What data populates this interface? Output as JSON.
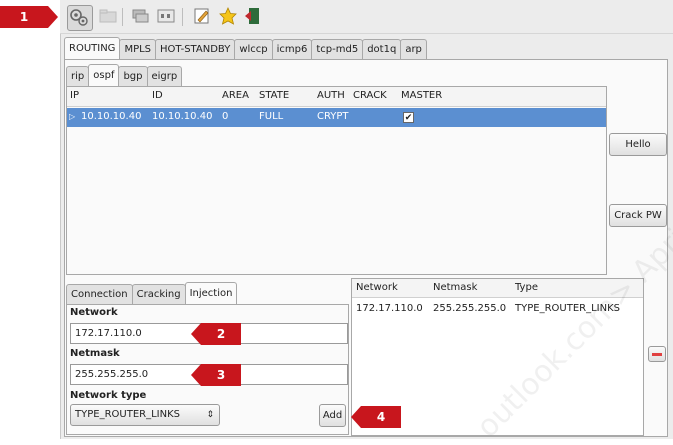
{
  "toolbar": {
    "icons": [
      "plugins-icon",
      "folder-icon",
      "network-icon",
      "interfaces-icon",
      "edit-icon",
      "star-icon",
      "exit-icon"
    ]
  },
  "protocol_tabs": [
    "ROUTING",
    "MPLS",
    "HOT-STANDBY",
    "wlccp",
    "icmp6",
    "tcp-md5",
    "dot1q",
    "arp"
  ],
  "routing_tabs": [
    "rip",
    "ospf",
    "bgp",
    "eigrp"
  ],
  "neighbors": {
    "columns": [
      "IP",
      "ID",
      "AREA",
      "STATE",
      "AUTH",
      "CRACK",
      "MASTER"
    ],
    "rows": [
      {
        "ip": "10.10.10.40",
        "id": "10.10.10.40",
        "area": "0",
        "state": "FULL",
        "auth": "CRYPT",
        "crack": "",
        "master": "✔"
      }
    ]
  },
  "buttons": {
    "hello": "Hello",
    "crack_pw": "Crack PW",
    "add": "Add"
  },
  "bottom_tabs": [
    "Connection",
    "Cracking",
    "Injection"
  ],
  "injection": {
    "network_label": "Network",
    "network_value": "172.17.110.0",
    "netmask_label": "Netmask",
    "netmask_value": "255.255.255.0",
    "network_type_label": "Network type",
    "network_type_value": "TYPE_ROUTER_LINKS"
  },
  "networks_table": {
    "columns": [
      "Network",
      "Netmask",
      "Type"
    ],
    "rows": [
      {
        "network": "172.17.110.0",
        "netmask": "255.255.255.0",
        "type": "TYPE_ROUTER_LINKS"
      }
    ]
  },
  "callouts": [
    "1",
    "2",
    "3",
    "4"
  ],
  "watermark": "outlook.com> Apri",
  "colors": {
    "selection": "#5b8fd1",
    "callout": "#c8161d",
    "remove": "#e04040"
  }
}
